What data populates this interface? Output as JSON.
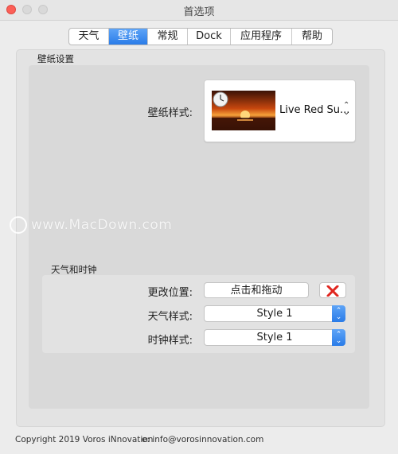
{
  "window": {
    "title": "首选项"
  },
  "tabs": [
    {
      "label": "天气",
      "active": false
    },
    {
      "label": "壁纸",
      "active": true
    },
    {
      "label": "常规",
      "active": false
    },
    {
      "label": "Dock",
      "active": false
    },
    {
      "label": "应用程序",
      "active": false
    },
    {
      "label": "帮助",
      "active": false
    }
  ],
  "wallpaper_section": {
    "title": "壁纸设置",
    "style_label": "壁纸样式:",
    "style_value": "Live Red Su...",
    "thumbnail_icon": "sunset-clock-thumbnail"
  },
  "weather_clock_section": {
    "title": "天气和时钟",
    "position_label": "更改位置:",
    "position_button": "点击和拖动",
    "clear_icon": "red-x-icon",
    "weather_style_label": "天气样式:",
    "weather_style_value": "Style 1",
    "clock_style_label": "时钟样式:",
    "clock_style_value": "Style 1"
  },
  "watermark": "www.MacDown.com",
  "footer": {
    "copyright": "Copyright 2019 Voros iNnovation",
    "email": "e: info@vorosinnovation.com"
  },
  "colors": {
    "accent": "#2a7ce8",
    "close": "#fc5f57",
    "clear_x": "#e0261f"
  }
}
